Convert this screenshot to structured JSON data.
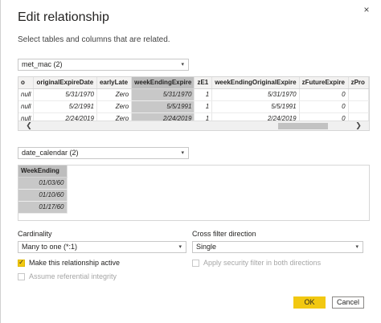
{
  "dialog": {
    "title": "Edit relationship",
    "subtitle": "Select tables and columns that are related.",
    "close_glyph": "×"
  },
  "table1": {
    "selected": "met_mac (2)",
    "columns": [
      "o",
      "originalExpireDate",
      "earlyLate",
      "weekEndingExpire",
      "zE1",
      "weekEndingOriginalExpire",
      "zFutureExpire",
      "zPro"
    ],
    "selected_column": "weekEndingExpire",
    "rows": [
      [
        "null",
        "5/31/1970",
        "Zero",
        "5/31/1970",
        "1",
        "5/31/1970",
        "0",
        ""
      ],
      [
        "null",
        "5/2/1991",
        "Zero",
        "5/5/1991",
        "1",
        "5/5/1991",
        "0",
        ""
      ],
      [
        "null",
        "2/24/2019",
        "Zero",
        "2/24/2019",
        "1",
        "2/24/2019",
        "0",
        ""
      ]
    ],
    "scroll_left": "❮",
    "scroll_right": "❯"
  },
  "table2": {
    "selected": "date_calendar (2)",
    "columns": [
      "WeekEnding"
    ],
    "selected_column": "WeekEnding",
    "rows": [
      [
        "01/03/60"
      ],
      [
        "01/10/60"
      ],
      [
        "01/17/60"
      ]
    ]
  },
  "cardinality": {
    "label": "Cardinality",
    "value": "Many to one (*:1)"
  },
  "cross_filter": {
    "label": "Cross filter direction",
    "value": "Single"
  },
  "options": {
    "active": {
      "label": "Make this relationship active",
      "checked": true
    },
    "referential": {
      "label": "Assume referential integrity",
      "checked": false
    },
    "security": {
      "label": "Apply security filter in both directions",
      "checked": false
    }
  },
  "buttons": {
    "ok": "OK",
    "cancel": "Cancel"
  },
  "icons": {
    "chevron": "▾",
    "checkmark": "✓"
  },
  "colors": {
    "accent": "#f2c811",
    "selected_column": "#c8c8c8"
  }
}
